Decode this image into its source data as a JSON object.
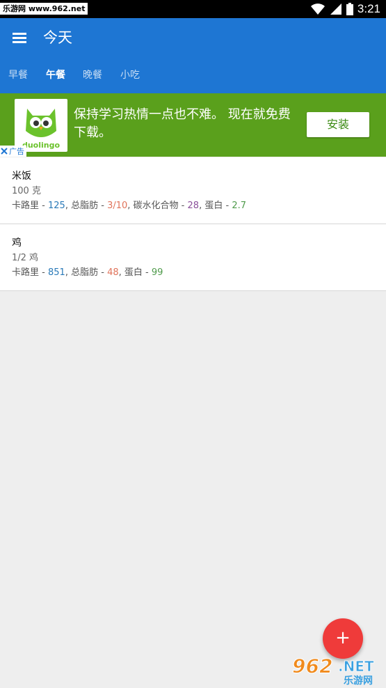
{
  "status_bar": {
    "watermark": "乐游网 www.962.net",
    "time": "3:21",
    "icons": [
      "wifi-icon",
      "signal-icon",
      "battery-icon"
    ]
  },
  "app_bar": {
    "title": "今天",
    "menu_icon": "menu-icon",
    "tabs": [
      {
        "label": "早餐",
        "active": false
      },
      {
        "label": "午餐",
        "active": true
      },
      {
        "label": "晚餐",
        "active": false
      },
      {
        "label": "小吃",
        "active": false
      }
    ]
  },
  "ad": {
    "logo_text": "duolingo",
    "text": "保持学习热情一点也不难。 现在就免费下载。",
    "button_label": "安装",
    "badge_label": "广告",
    "badge_icon": "close-x-icon"
  },
  "foods": [
    {
      "name": "米饭",
      "quantity": "100 克",
      "nutrients": [
        {
          "label": "卡路里",
          "value": "125",
          "kind": "cal"
        },
        {
          "label": "总脂肪",
          "value": "3/10",
          "kind": "fat"
        },
        {
          "label": "碳水化合物",
          "value": "28",
          "kind": "carb"
        },
        {
          "label": "蛋白",
          "value": "2.7",
          "kind": "prot"
        }
      ]
    },
    {
      "name": "鸡",
      "quantity": "1/2 鸡",
      "nutrients": [
        {
          "label": "卡路里",
          "value": "851",
          "kind": "cal"
        },
        {
          "label": "总脂肪",
          "value": "48",
          "kind": "fat"
        },
        {
          "label": "蛋白",
          "value": "99",
          "kind": "prot"
        }
      ]
    }
  ],
  "fab": {
    "label": "+"
  },
  "bottom_watermark": {
    "brand": "962",
    "suffix": ".NET",
    "sub": "乐游网"
  },
  "colors": {
    "primary": "#1e76d3",
    "ad_green": "#5aa01c",
    "fab": "#ef3b3a",
    "calories": "#2a7ab8",
    "fat": "#e0735a",
    "carbs": "#8a4f9a",
    "protein": "#4e9a4a"
  }
}
